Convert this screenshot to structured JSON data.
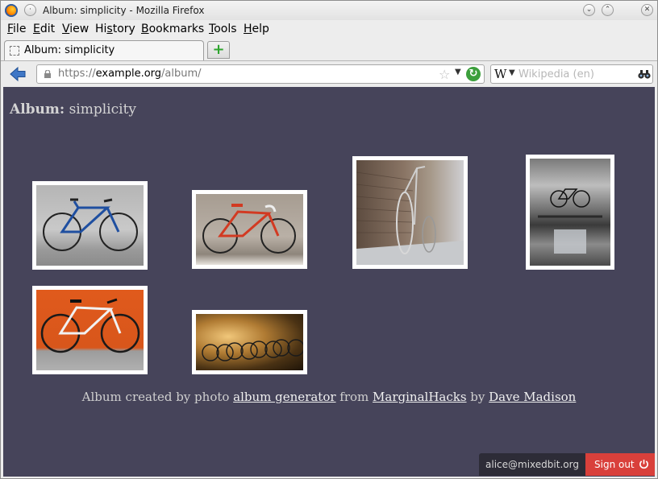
{
  "window": {
    "title": "Album: simplicity - Mozilla Firefox"
  },
  "menu": [
    "File",
    "Edit",
    "View",
    "History",
    "Bookmarks",
    "Tools",
    "Help"
  ],
  "menu_accel": [
    "F",
    "E",
    "V",
    "s",
    "B",
    "T",
    "H"
  ],
  "tab": {
    "label": "Album: simplicity",
    "new_tab": "+"
  },
  "nav": {
    "url_scheme": "https://",
    "url_domain": "example.org",
    "url_path": "/album/",
    "search_placeholder": "Wikipedia (en)",
    "search_engine_icon": "W"
  },
  "page": {
    "heading_bold": "Album:",
    "heading_rest": " simplicity",
    "credit_prefix": "Album created by photo ",
    "credit_link1": "album generator",
    "credit_mid1": " from ",
    "credit_link2": "MarginalHacks",
    "credit_mid2": " by ",
    "credit_link3": "Dave Madison"
  },
  "photos": [
    {
      "name": "blue-road-bike"
    },
    {
      "name": "red-fixed-gear-bike"
    },
    {
      "name": "bike-against-brick-wall"
    },
    {
      "name": "bike-reflection-square"
    },
    {
      "name": "white-bike-orange-wall"
    },
    {
      "name": "bikes-in-row-night"
    }
  ],
  "session": {
    "user": "alice@mixedbit.org",
    "sign_out": "Sign out"
  },
  "colors": {
    "page_bg": "#46445a",
    "sign_out_bg": "#d9403b",
    "user_bg": "#2d2c37"
  }
}
